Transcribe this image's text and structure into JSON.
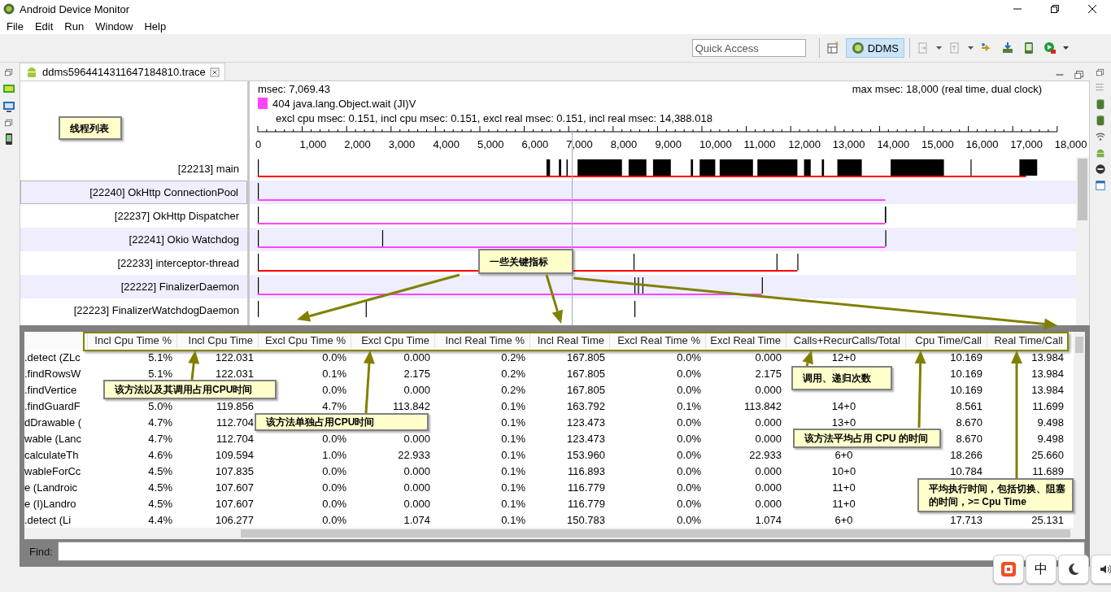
{
  "window": {
    "title": "Android Device Monitor"
  },
  "menu": [
    "File",
    "Edit",
    "Run",
    "Window",
    "Help"
  ],
  "toolbar": {
    "quick_access": {
      "placeholder": "Quick Access"
    },
    "perspective": {
      "label": "DDMS",
      "selected": true
    }
  },
  "editor_tab": {
    "title": "ddms5964414311647184810.trace"
  },
  "trace": {
    "time": "msec: 7,069.43",
    "max": "max msec: 18,000 (real time, dual clock)",
    "method": {
      "color": "#ff44ff",
      "label": "404 java.lang.Object.wait (JI)V"
    },
    "stats": "excl cpu msec: 0.151, incl cpu msec: 0.151, excl real msec: 0.151, incl real msec: 14,388.018",
    "ticks": [
      "0",
      "1,000",
      "2,000",
      "3,000",
      "4,000",
      "5,000",
      "6,000",
      "7,000",
      "8,000",
      "9,000",
      "10,000",
      "11,000",
      "12,000",
      "13,000",
      "14,000",
      "15,000",
      "16,000",
      "17,000",
      "18,000"
    ]
  },
  "threads": [
    {
      "name": "[22213] main",
      "color": "#ff0000",
      "selected": false
    },
    {
      "name": "[22240] OkHttp ConnectionPool",
      "color": "#ff44ff",
      "selected": true
    },
    {
      "name": "[22237] OkHttp Dispatcher",
      "color": "#ff44ff",
      "selected": false
    },
    {
      "name": "[22241] Okio Watchdog",
      "color": "#ff44ff",
      "selected": false
    },
    {
      "name": "[22233] interceptor-thread",
      "color": "#ff0000",
      "selected": false
    },
    {
      "name": "[22222] FinalizerDaemon",
      "color": "#ff44ff",
      "selected": false
    },
    {
      "name": "[22223] FinalizerWatchdogDaemon",
      "selected": false
    }
  ],
  "table": {
    "columns": [
      "Incl Cpu Time %",
      "Incl Cpu Time",
      "Excl Cpu Time %",
      "Excl Cpu Time",
      "Incl Real Time %",
      "Incl Real Time",
      "Excl Real Time %",
      "Excl Real Time",
      "Calls+RecurCalls/Total",
      "Cpu Time/Call",
      "Real Time/Call"
    ],
    "rows": [
      {
        "name": ".detect (ZLc",
        "cells": [
          "5.1%",
          "122.031",
          "0.0%",
          "0.000",
          "0.2%",
          "167.805",
          "0.0%",
          "0.000",
          "12+0",
          "10.169",
          "13.984"
        ]
      },
      {
        "name": ".findRowsW",
        "cells": [
          "5.1%",
          "122.031",
          "0.1%",
          "2.175",
          "0.2%",
          "167.805",
          "0.0%",
          "2.175",
          null,
          "10.169",
          "13.984"
        ]
      },
      {
        "name": ".findVertice",
        "cells": [
          null,
          null,
          "0.0%",
          "0.000",
          "0.2%",
          "167.805",
          "0.0%",
          "0.000",
          null,
          "10.169",
          "13.984"
        ]
      },
      {
        "name": ".findGuardF",
        "cells": [
          "5.0%",
          "119.856",
          "4.7%",
          "113.842",
          "0.1%",
          "163.792",
          "0.1%",
          "113.842",
          "14+0",
          "8.561",
          "11.699"
        ]
      },
      {
        "name": "dDrawable (",
        "cells": [
          "4.7%",
          "112.704",
          null,
          null,
          "0.1%",
          "123.473",
          "0.0%",
          "0.000",
          "13+0",
          "8.670",
          "9.498"
        ]
      },
      {
        "name": "wable (Lanc",
        "cells": [
          "4.7%",
          "112.704",
          "0.0%",
          "0.000",
          "0.1%",
          "123.473",
          "0.0%",
          "0.000",
          null,
          "8.670",
          "9.498"
        ]
      },
      {
        "name": "calculateTh",
        "cells": [
          "4.6%",
          "109.594",
          "1.0%",
          "22.933",
          "0.1%",
          "153.960",
          "0.0%",
          "22.933",
          "6+0",
          "18.266",
          "25.660"
        ]
      },
      {
        "name": "wableForCc",
        "cells": [
          "4.5%",
          "107.835",
          "0.0%",
          "0.000",
          "0.1%",
          "116.893",
          "0.0%",
          "0.000",
          "10+0",
          "10.784",
          "11.689"
        ]
      },
      {
        "name": "e (Landroic",
        "cells": [
          "4.5%",
          "107.607",
          "0.0%",
          "0.000",
          "0.1%",
          "116.779",
          "0.0%",
          "0.000",
          "11+0",
          null,
          null
        ]
      },
      {
        "name": "e (I)Landro",
        "cells": [
          "4.5%",
          "107.607",
          "0.0%",
          "0.000",
          "0.1%",
          "116.779",
          "0.0%",
          "0.000",
          "11+0",
          null,
          null
        ]
      },
      {
        "name": ".detect (Li",
        "cells": [
          "4.4%",
          "106.277",
          "0.0%",
          "1.074",
          "0.1%",
          "150.783",
          "0.0%",
          "1.074",
          "6+0",
          "17.713",
          "25.131"
        ]
      }
    ]
  },
  "find": {
    "label": "Find:"
  },
  "callouts": [
    {
      "text": "线程列表"
    },
    {
      "text": "一些关键指标"
    },
    {
      "text": "该方法以及其调用占用CPU时间"
    },
    {
      "text": "该方法单独占用CPU时间"
    },
    {
      "text": "调用、递归次数"
    },
    {
      "text": "该方法平均占用 CPU 的时间"
    },
    {
      "text": "平均执行时间，包括切换、阻塞的时间，>= Cpu Time"
    }
  ],
  "ime": {
    "label": "中"
  }
}
